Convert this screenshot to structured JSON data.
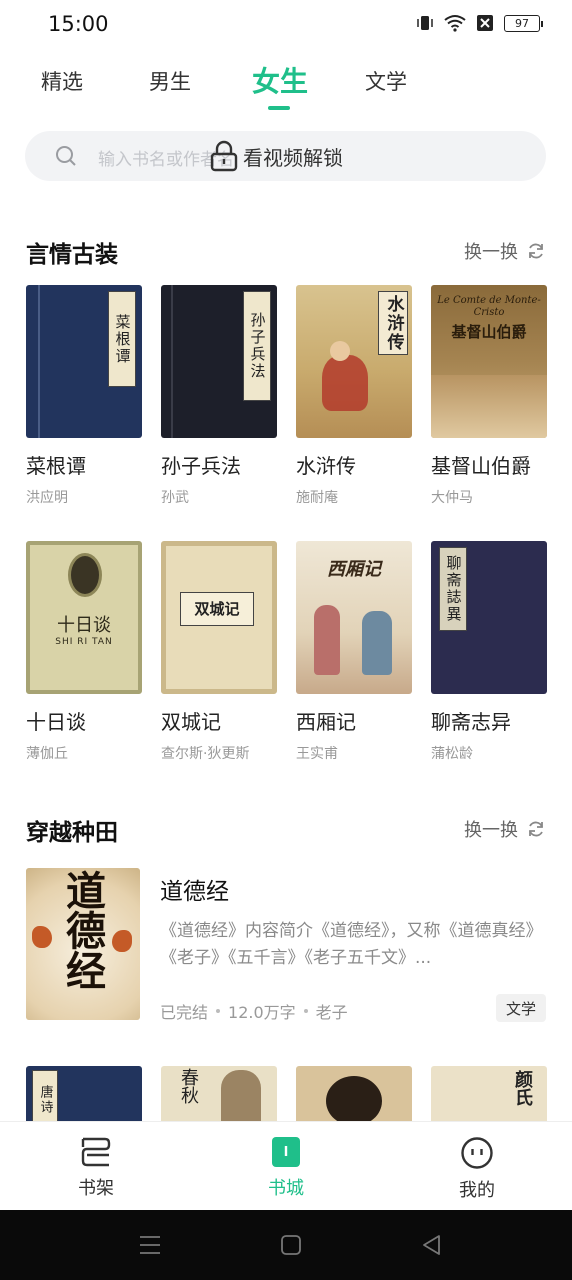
{
  "status": {
    "time": "15:00",
    "battery": "97"
  },
  "tabs": [
    {
      "label": "精选",
      "active": false
    },
    {
      "label": "男生",
      "active": false
    },
    {
      "label": "女生",
      "active": true
    },
    {
      "label": "文学",
      "active": false
    }
  ],
  "search": {
    "placeholder": "输入书名或作者名",
    "overlay_text": "看视频解锁",
    "icon": "search-icon",
    "overlay_icon": "lock-icon"
  },
  "sections": [
    {
      "title": "言情古装",
      "refresh_label": "换一换",
      "books": [
        {
          "title": "菜根谭",
          "author": "洪应明",
          "cover_text": "菜根谭"
        },
        {
          "title": "孙子兵法",
          "author": "孙武",
          "cover_text": "孙子兵法"
        },
        {
          "title": "水浒传",
          "author": "施耐庵",
          "cover_text": "水浒传"
        },
        {
          "title": "基督山伯爵",
          "author": "大仲马",
          "cover_text": "基督山伯爵",
          "cover_subtext": "Le Comte de Monte-Cristo"
        },
        {
          "title": "十日谈",
          "author": "薄伽丘",
          "cover_text": "十日谈",
          "cover_subtext": "SHI RI TAN"
        },
        {
          "title": "双城记",
          "author": "查尔斯·狄更斯",
          "cover_text": "双城记"
        },
        {
          "title": "西厢记",
          "author": "王实甫",
          "cover_text": "西厢记"
        },
        {
          "title": "聊斋志异",
          "author": "蒲松龄",
          "cover_text": "聊斋誌異"
        }
      ]
    },
    {
      "title": "穿越种田",
      "refresh_label": "换一换",
      "featured": {
        "title": "道德经",
        "description": "《道德经》内容简介《道德经》，又称《道德真经》《老子》《五千言》《老子五千文》...",
        "status": "已完结",
        "words": "12.0万字",
        "author": "老子",
        "genre": "文学",
        "cover_text": "道德经"
      },
      "partial_covers": [
        "唐诗",
        "春秋",
        "",
        "颜氏"
      ]
    }
  ],
  "bottom_nav": [
    {
      "label": "书架",
      "icon": "bookshelf-icon",
      "active": false
    },
    {
      "label": "书城",
      "icon": "bookstore-icon",
      "active": true
    },
    {
      "label": "我的",
      "icon": "profile-icon",
      "active": false
    }
  ],
  "colors": {
    "accent": "#1fbf8a",
    "text": "#222222",
    "muted": "#999999"
  }
}
